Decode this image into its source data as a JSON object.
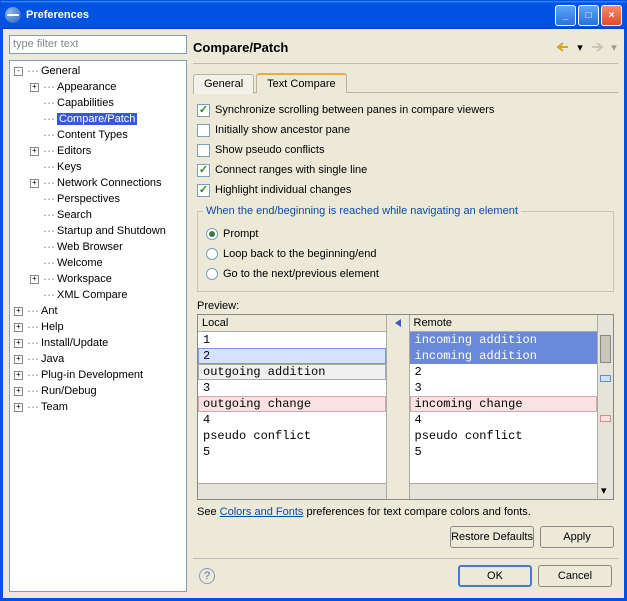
{
  "window": {
    "title": "Preferences"
  },
  "filter": {
    "placeholder": "type filter text"
  },
  "tree": {
    "items": [
      {
        "label": "General",
        "level": 1,
        "expand": "-"
      },
      {
        "label": "Appearance",
        "level": 2,
        "expand": "+"
      },
      {
        "label": "Capabilities",
        "level": 2,
        "expand": ""
      },
      {
        "label": "Compare/Patch",
        "level": 2,
        "expand": "",
        "selected": true
      },
      {
        "label": "Content Types",
        "level": 2,
        "expand": ""
      },
      {
        "label": "Editors",
        "level": 2,
        "expand": "+"
      },
      {
        "label": "Keys",
        "level": 2,
        "expand": ""
      },
      {
        "label": "Network Connections",
        "level": 2,
        "expand": "+"
      },
      {
        "label": "Perspectives",
        "level": 2,
        "expand": ""
      },
      {
        "label": "Search",
        "level": 2,
        "expand": ""
      },
      {
        "label": "Startup and Shutdown",
        "level": 2,
        "expand": ""
      },
      {
        "label": "Web Browser",
        "level": 2,
        "expand": ""
      },
      {
        "label": "Welcome",
        "level": 2,
        "expand": ""
      },
      {
        "label": "Workspace",
        "level": 2,
        "expand": "+"
      },
      {
        "label": "XML Compare",
        "level": 2,
        "expand": ""
      },
      {
        "label": "Ant",
        "level": 1,
        "expand": "+"
      },
      {
        "label": "Help",
        "level": 1,
        "expand": "+"
      },
      {
        "label": "Install/Update",
        "level": 1,
        "expand": "+"
      },
      {
        "label": "Java",
        "level": 1,
        "expand": "+"
      },
      {
        "label": "Plug-in Development",
        "level": 1,
        "expand": "+"
      },
      {
        "label": "Run/Debug",
        "level": 1,
        "expand": "+"
      },
      {
        "label": "Team",
        "level": 1,
        "expand": "+"
      }
    ]
  },
  "page": {
    "title": "Compare/Patch",
    "tabs": [
      {
        "label": "General",
        "active": false
      },
      {
        "label": "Text Compare",
        "active": true
      }
    ],
    "checkboxes": [
      {
        "label": "Synchronize scrolling between panes in compare viewers",
        "checked": true
      },
      {
        "label": "Initially show ancestor pane",
        "checked": false
      },
      {
        "label": "Show pseudo conflicts",
        "checked": false
      },
      {
        "label": "Connect ranges with single line",
        "checked": true
      },
      {
        "label": "Highlight individual changes",
        "checked": true
      }
    ],
    "navgroup": {
      "legend": "When the end/beginning is reached while navigating an element",
      "options": [
        {
          "label": "Prompt",
          "checked": true
        },
        {
          "label": "Loop back to the beginning/end",
          "checked": false
        },
        {
          "label": "Go to the next/previous element",
          "checked": false
        }
      ]
    },
    "preview": {
      "label": "Preview:",
      "local_header": "Local",
      "remote_header": "Remote",
      "local_lines": [
        {
          "text": "1",
          "cls": ""
        },
        {
          "text": "2",
          "cls": "incoming"
        },
        {
          "text": "outgoing addition",
          "cls": "outgoing"
        },
        {
          "text": "3",
          "cls": ""
        },
        {
          "text": "outgoing change",
          "cls": "outchange"
        },
        {
          "text": "4",
          "cls": ""
        },
        {
          "text": "pseudo conflict",
          "cls": ""
        },
        {
          "text": "5",
          "cls": ""
        }
      ],
      "remote_lines": [
        {
          "text": "incoming addition",
          "cls": "sel"
        },
        {
          "text": "incoming addition",
          "cls": "sel"
        },
        {
          "text": "2",
          "cls": ""
        },
        {
          "text": "3",
          "cls": ""
        },
        {
          "text": "incoming change",
          "cls": "inchange"
        },
        {
          "text": "4",
          "cls": ""
        },
        {
          "text": "pseudo conflict",
          "cls": ""
        },
        {
          "text": "5",
          "cls": ""
        }
      ]
    },
    "footer_note_prefix": "See ",
    "footer_note_link": "Colors and Fonts",
    "footer_note_suffix": " preferences for text compare colors and fonts.",
    "buttons": {
      "restore": "Restore Defaults",
      "apply": "Apply",
      "ok": "OK",
      "cancel": "Cancel"
    }
  }
}
